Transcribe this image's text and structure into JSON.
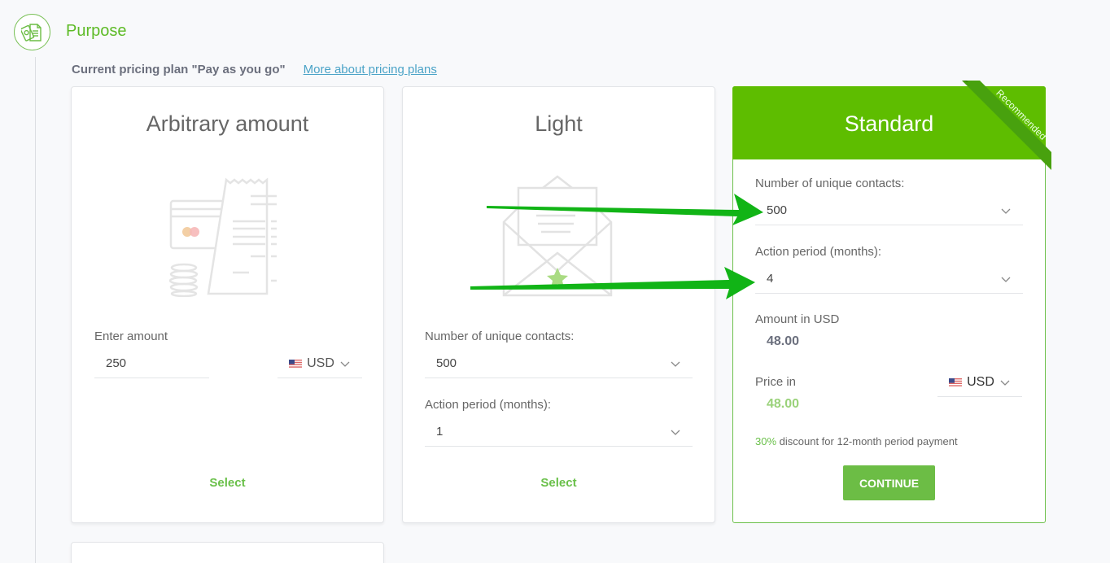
{
  "step": {
    "title": "Purpose",
    "icon": "documents-money-icon"
  },
  "plan_info": {
    "current_plan": "Current pricing plan \"Pay as you go\"",
    "more_link": "More about pricing plans"
  },
  "cards": [
    {
      "title": "Arbitrary amount",
      "illustration": "card-receipt-coins-icon",
      "amount_label": "Enter amount",
      "amount_value": "250",
      "currency": "USD",
      "select_label": "Select"
    },
    {
      "title": "Light",
      "illustration": "open-envelope-star-icon",
      "contacts_label": "Number of unique contacts:",
      "contacts_value": "500",
      "period_label": "Action period (months):",
      "period_value": "1",
      "select_label": "Select"
    },
    {
      "title": "Standard",
      "badge": "Recommended",
      "contacts_label": "Number of unique contacts:",
      "contacts_value": "500",
      "period_label": "Action period (months):",
      "period_value": "4",
      "amount_label": "Amount in USD",
      "amount_value": "48.00",
      "price_label": "Price in",
      "price_value": "48.00",
      "currency": "USD",
      "discount_pct": "30%",
      "discount_text": " discount for 12-month period payment",
      "continue_label": "CONTINUE"
    }
  ],
  "annotations": {
    "arrow_color": "#11b416",
    "arrow_count": 2
  },
  "colors": {
    "brand_green": "#5ebd00",
    "link_blue": "#4ba3c7",
    "button_green": "#6cbd45"
  }
}
